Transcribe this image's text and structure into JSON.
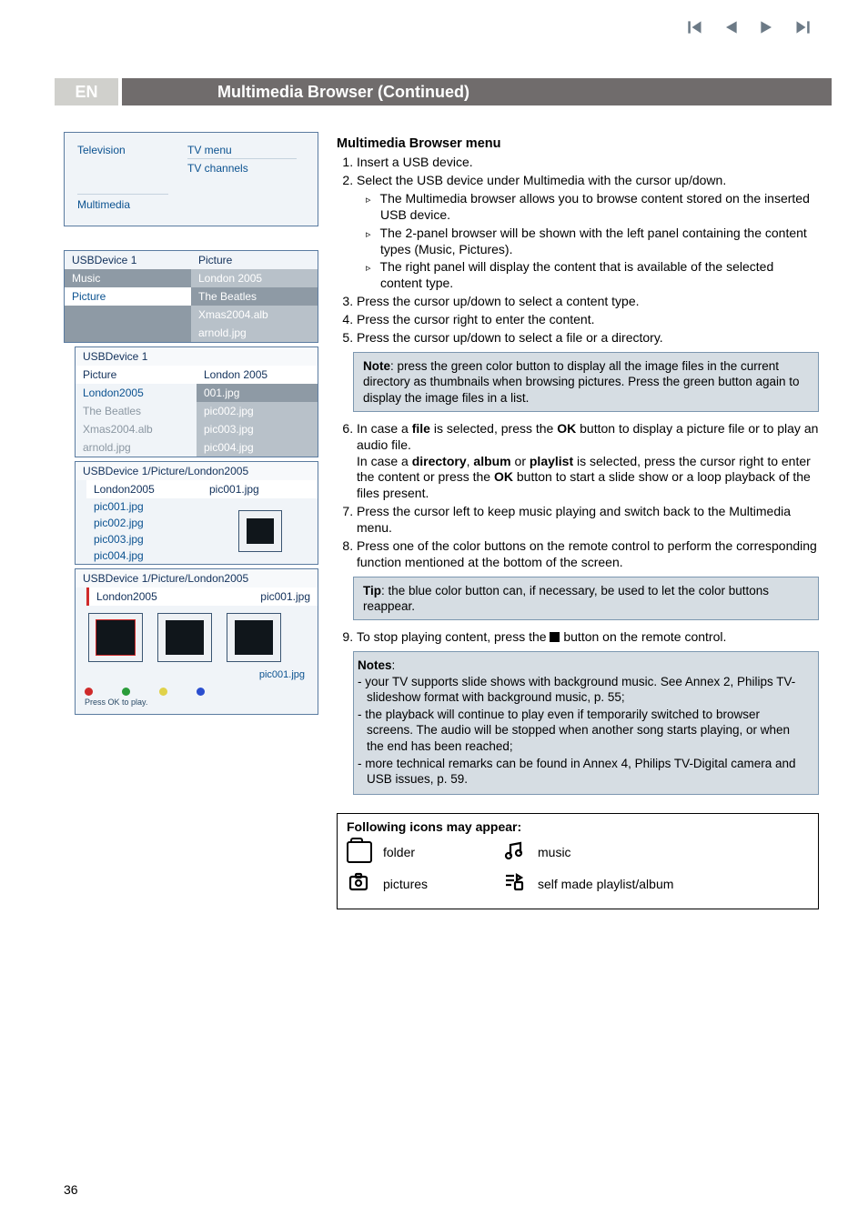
{
  "header": {
    "lang": "EN",
    "title": "Multimedia Browser  (Continued)"
  },
  "tvbox": {
    "television": "Television",
    "tv_menu": "TV menu",
    "tv_channels": "TV channels",
    "multimedia": "Multimedia"
  },
  "panel1": {
    "usb": "USBDevice 1",
    "picture": "Picture",
    "music": "Music",
    "london": "London 2005",
    "picture2": "Picture",
    "beatles": "The Beatles",
    "xmas": "Xmas2004.alb",
    "arnold": "arnold.jpg"
  },
  "panel2": {
    "usb": "USBDevice 1",
    "picture": "Picture",
    "london": "London 2005",
    "london2005": "London2005",
    "p001": "001.jpg",
    "beatles": "The Beatles",
    "p002": "pic002.jpg",
    "xmas": "Xmas2004.alb",
    "p003": "pic003.jpg",
    "arnold": "arnold.jpg",
    "p004": "pic004.jpg"
  },
  "panel3": {
    "breadcrumb": "USBDevice 1/Picture/London2005",
    "london": "London2005",
    "pic001": "pic001.jpg",
    "l1": "pic001.jpg",
    "l2": "pic002.jpg",
    "l3": "pic003.jpg",
    "l4": "pic004.jpg"
  },
  "panel4": {
    "breadcrumb": "USBDevice 1/Picture/London2005",
    "london": "London2005",
    "pic001": "pic001.jpg",
    "thumblabel": "pic001.jpg",
    "hint": "Press OK to play."
  },
  "right": {
    "heading": "Multimedia Browser menu",
    "steps": {
      "s1": "Insert a USB device.",
      "s2": "Select the USB device under Multimedia with the cursor up/down.",
      "s2a": "The Multimedia browser allows you to browse content stored on the inserted USB device.",
      "s2b": "The 2-panel browser will be shown with the left panel containing the content types (Music, Pictures).",
      "s2c": "The right panel will display the content that is available of the selected content type.",
      "s3": "Press the cursor up/down to select a content type.",
      "s4": "Press the cursor right to enter the content.",
      "s5": "Press the cursor up/down to select a file or a directory."
    },
    "notebox": "Note: press the green color button to display all the image files in the current directory as thumbnails when browsing pictures. Press the green button again to display the image files in a list.",
    "s6a": "In case a ",
    "s6b": "file",
    "s6c": " is selected, press the ",
    "s6d": "OK",
    "s6e": " button to display a picture file or to play an audio file.",
    "s6f": "In case a ",
    "s6g": "directory",
    "s6h": ", ",
    "s6i": "album",
    "s6j": " or ",
    "s6k": "playlist",
    "s6l": " is selected, press the cursor right to enter the content or press the ",
    "s6m": "OK",
    "s6n": " button to start a slide show or a loop playback of the files present.",
    "s7": "Press the cursor left to keep music playing and switch back to the Multimedia menu.",
    "s8": "Press one of the color buttons on the remote control to perform the corresponding function mentioned at the bottom of the screen.",
    "tipbox": "Tip: the blue color button can, if necessary, be used to let the color buttons reappear.",
    "s9a": "To stop playing content, press the ",
    "s9b": " button on the remote control.",
    "notes_title": "Notes",
    "n1": "- your TV supports slide shows with background music. See Annex 2, Philips TV-slideshow format with background music, p. 55;",
    "n2": "- the playback will continue to play even if temporarily switched to browser screens. The audio will be stopped when another song starts playing, or when the end has been reached;",
    "n3": "- more technical remarks can be found in Annex 4, Philips TV-Digital camera and USB issues, p. 59.",
    "icons_title": "Following icons may appear:",
    "icon_folder": "folder",
    "icon_music": "music",
    "icon_pictures": "pictures",
    "icon_playlist": "self made playlist/album"
  },
  "page_number": "36"
}
